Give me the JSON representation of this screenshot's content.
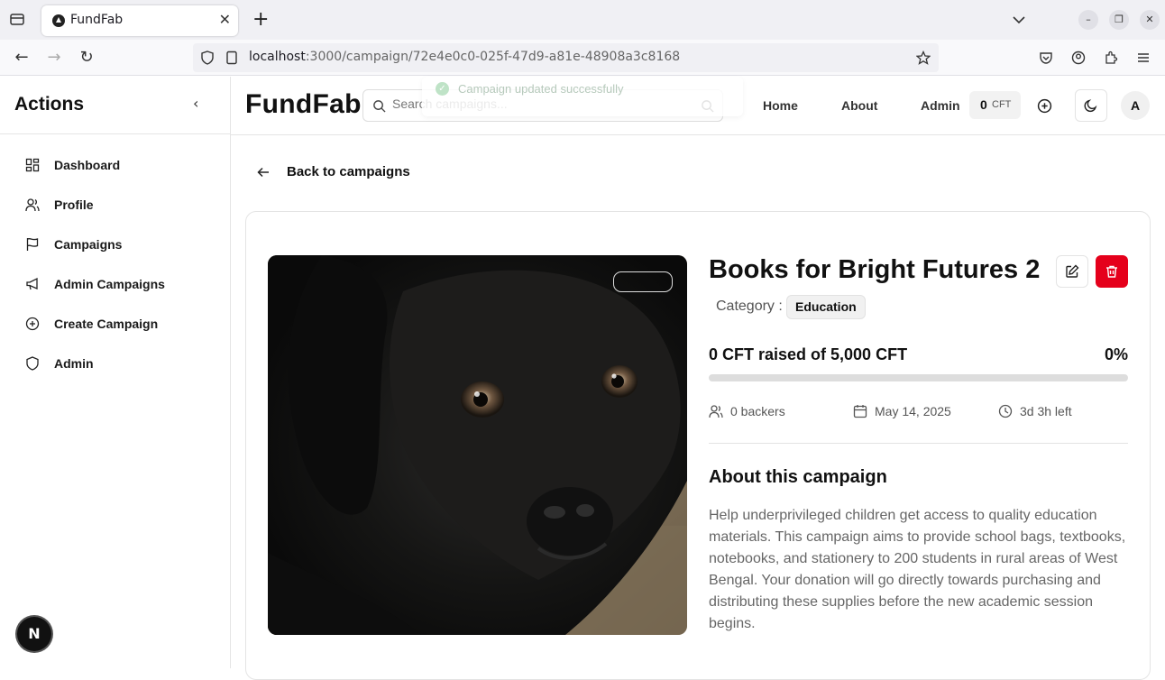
{
  "browser": {
    "tab_title": "FundFab",
    "url_host": "localhost",
    "url_path": ":3000/campaign/72e4e0c0-025f-47d9-a81e-48908a3c8168"
  },
  "sidebar": {
    "title": "Actions",
    "items": [
      {
        "label": "Dashboard",
        "icon": "dashboard-icon"
      },
      {
        "label": "Profile",
        "icon": "user-icon"
      },
      {
        "label": "Campaigns",
        "icon": "flag-icon"
      },
      {
        "label": "Admin Campaigns",
        "icon": "megaphone-icon"
      },
      {
        "label": "Create Campaign",
        "icon": "plus-circle-icon"
      },
      {
        "label": "Admin",
        "icon": "shield-icon"
      }
    ],
    "dev_badge": "N"
  },
  "header": {
    "brand": "FundFab",
    "search_placeholder": "Search campaigns...",
    "toast": "Campaign updated successfully",
    "nav": [
      "Home",
      "About",
      "Admin"
    ],
    "cft_balance": "0",
    "cft_unit": "CFT",
    "avatar_initial": "A"
  },
  "main": {
    "back_label": "Back to campaigns",
    "campaign": {
      "title": "Books for Bright Futures 2",
      "category_label": "Category :",
      "category": "Education",
      "raised_text": "0 CFT raised of 5,000 CFT",
      "percent_text": "0%",
      "progress": 0,
      "backers": "0 backers",
      "date": "May 14, 2025",
      "time_left": "3d 3h left",
      "about_title": "About this campaign",
      "about_text": "Help underprivileged children get access to quality education materials. This campaign aims to provide school bags, textbooks, notebooks, and stationery to 200 students in rural areas of West Bengal. Your donation will go directly towards purchasing and distributing these supplies before the new academic session begins."
    }
  },
  "colors": {
    "delete_red": "#e5001b",
    "toast_green": "#bfe3c7"
  }
}
